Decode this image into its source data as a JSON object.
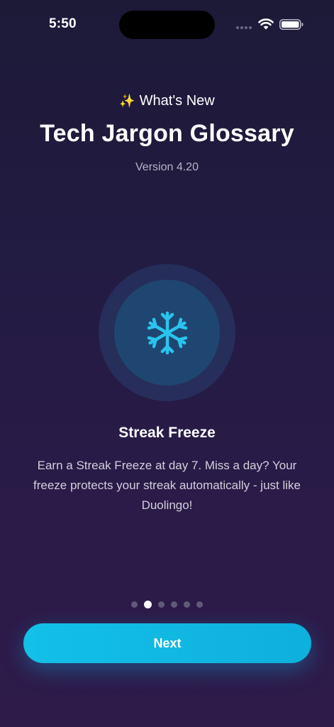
{
  "status_bar": {
    "time": "5:50"
  },
  "header": {
    "badge_emoji": "✨",
    "badge_label": "What's New",
    "app_title": "Tech Jargon Glossary",
    "version": "Version 4.20"
  },
  "feature": {
    "icon": "snowflake-icon",
    "icon_color": "#29c4ee",
    "title": "Streak Freeze",
    "description": "Earn a Streak Freeze at day 7. Miss a day? Your freeze protects your streak automatically - just like Duolingo!"
  },
  "pagination": {
    "total": 6,
    "current": 2
  },
  "actions": {
    "next_label": "Next"
  },
  "colors": {
    "accent": "#12c0e8",
    "background_top": "#1d1a38",
    "background_bottom": "#2e1b4a"
  }
}
